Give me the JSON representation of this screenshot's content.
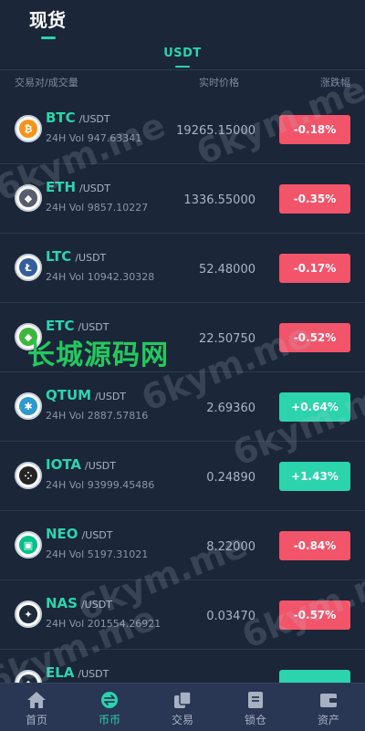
{
  "header": {
    "title": "现货"
  },
  "tabs": [
    {
      "label": "USDT",
      "active": true
    }
  ],
  "columns": {
    "pair": "交易对/成交量",
    "price": "实时价格",
    "change": "涨跌幅"
  },
  "coins": [
    {
      "symbol": "BTC",
      "quote": "/USDT",
      "volume": "24H Vol 947.63341",
      "price": "19265.15000",
      "change": "-0.18%",
      "direction": "down",
      "icon": "bitcoin-icon",
      "color": "#f7931a",
      "glyph": "₿"
    },
    {
      "symbol": "ETH",
      "quote": "/USDT",
      "volume": "24H Vol 9857.10227",
      "price": "1336.55000",
      "change": "-0.35%",
      "direction": "down",
      "icon": "ethereum-icon",
      "color": "#555d6e",
      "glyph": "◆"
    },
    {
      "symbol": "LTC",
      "quote": "/USDT",
      "volume": "24H Vol 10942.30328",
      "price": "52.48000",
      "change": "-0.17%",
      "direction": "down",
      "icon": "litecoin-icon",
      "color": "#345d9d",
      "glyph": "Ł"
    },
    {
      "symbol": "ETC",
      "quote": "/USDT",
      "volume": "",
      "price": "22.50750",
      "change": "-0.52%",
      "direction": "down",
      "icon": "ethereum-classic-icon",
      "color": "#3ab83a",
      "glyph": "◆"
    },
    {
      "symbol": "QTUM",
      "quote": "/USDT",
      "volume": "24H Vol 2887.57816",
      "price": "2.69360",
      "change": "+0.64%",
      "direction": "up",
      "icon": "qtum-icon",
      "color": "#2e9ad0",
      "glyph": "✱"
    },
    {
      "symbol": "IOTA",
      "quote": "/USDT",
      "volume": "24H Vol 93999.45486",
      "price": "0.24890",
      "change": "+1.43%",
      "direction": "up",
      "icon": "iota-icon",
      "color": "#242424",
      "glyph": "⁘"
    },
    {
      "symbol": "NEO",
      "quote": "/USDT",
      "volume": "24H Vol 5197.31021",
      "price": "8.22000",
      "change": "-0.84%",
      "direction": "down",
      "icon": "neo-icon",
      "color": "#00c08b",
      "glyph": "▣"
    },
    {
      "symbol": "NAS",
      "quote": "/USDT",
      "volume": "24H Vol 201554.26921",
      "price": "0.03470",
      "change": "-0.57%",
      "direction": "down",
      "icon": "nas-icon",
      "color": "#1e2a3a",
      "glyph": "✦"
    },
    {
      "symbol": "ELA",
      "quote": "/USDT",
      "volume": "",
      "price": "",
      "change": "",
      "direction": "up",
      "icon": "ela-icon",
      "color": "#1e2a3a",
      "glyph": "◆"
    }
  ],
  "watermarks": {
    "latin": "6kym.me",
    "chinese": "长城源码网"
  },
  "nav": [
    {
      "label": "首页",
      "icon": "home-icon",
      "active": false
    },
    {
      "label": "币币",
      "icon": "exchange-icon",
      "active": true
    },
    {
      "label": "交易",
      "icon": "trade-icon",
      "active": false
    },
    {
      "label": "锁仓",
      "icon": "lock-icon",
      "active": false
    },
    {
      "label": "资产",
      "icon": "wallet-icon",
      "active": false
    }
  ],
  "colors": {
    "background": "#1b2638",
    "accent": "#2bd4ad",
    "down": "#f2546a",
    "up": "#2bd4ad",
    "nav": "#293754"
  }
}
